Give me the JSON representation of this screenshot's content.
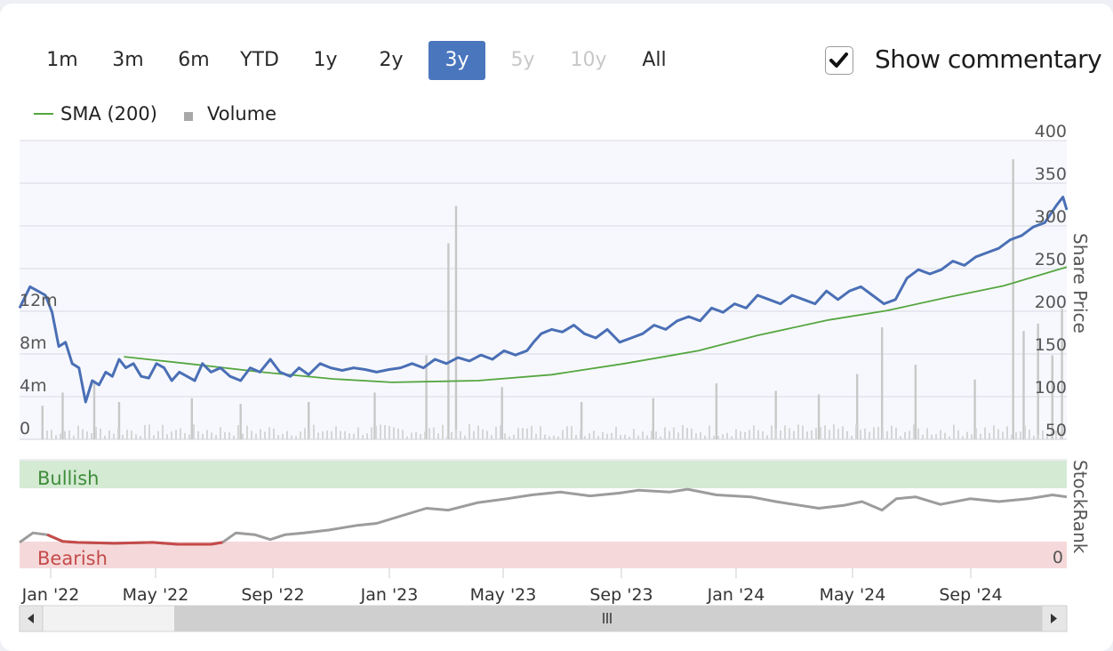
{
  "range_buttons": [
    {
      "label": "1m",
      "state": "normal"
    },
    {
      "label": "3m",
      "state": "normal"
    },
    {
      "label": "6m",
      "state": "normal"
    },
    {
      "label": "YTD",
      "state": "normal"
    },
    {
      "label": "1y",
      "state": "normal"
    },
    {
      "label": "2y",
      "state": "normal"
    },
    {
      "label": "3y",
      "state": "active"
    },
    {
      "label": "5y",
      "state": "disabled"
    },
    {
      "label": "10y",
      "state": "disabled"
    },
    {
      "label": "All",
      "state": "normal"
    }
  ],
  "commentary": {
    "label": "Show commentary",
    "checked": true
  },
  "colors": {
    "accent": "#4a76be",
    "price_line": "#4a6fb5",
    "sma_line": "#55a640",
    "volume_bar": "#c8c8c8",
    "bullish_band": "#d4ead3",
    "bearish_band": "#f5d9da",
    "bullish_text": "#3f8c3a",
    "bearish_text": "#c54a4a",
    "rank_line": "#9c9c9c",
    "rank_bearish_line": "#c54a4a"
  },
  "chart_data": {
    "type": "line",
    "legend": [
      {
        "name": "SMA (200)",
        "marker": "line"
      },
      {
        "name": "Volume",
        "marker": "square"
      }
    ],
    "x_ticks": [
      "Jan '22",
      "May '22",
      "Sep '22",
      "Jan '23",
      "May '23",
      "Sep '23",
      "Jan '24",
      "May '24",
      "Sep '24"
    ],
    "x_range": [
      "2021-12-22",
      "2024-12-20"
    ],
    "price_axis": {
      "title": "Share Price",
      "ticks": [
        50,
        100,
        150,
        200,
        250,
        300,
        350,
        400
      ],
      "range": [
        50,
        400
      ],
      "position": "right"
    },
    "volume_axis": {
      "ticks": [
        "0",
        "4m",
        "8m",
        "12m"
      ],
      "values": [
        0,
        4000000,
        8000000,
        12000000
      ],
      "range": [
        0,
        16000000
      ],
      "position": "left"
    },
    "price_series": {
      "name": "Share Price",
      "x": [
        "2021-12-22",
        "2022-01-02",
        "2022-01-10",
        "2022-01-18",
        "2022-01-25",
        "2022-02-01",
        "2022-02-08",
        "2022-02-15",
        "2022-02-22",
        "2022-03-01",
        "2022-03-08",
        "2022-03-15",
        "2022-03-22",
        "2022-03-29",
        "2022-04-05",
        "2022-04-12",
        "2022-04-20",
        "2022-04-28",
        "2022-05-06",
        "2022-05-14",
        "2022-05-22",
        "2022-05-30",
        "2022-06-07",
        "2022-06-15",
        "2022-06-23",
        "2022-07-01",
        "2022-07-10",
        "2022-07-20",
        "2022-07-30",
        "2022-08-10",
        "2022-08-20",
        "2022-08-30",
        "2022-09-10",
        "2022-09-20",
        "2022-10-01",
        "2022-10-10",
        "2022-10-20",
        "2022-11-01",
        "2022-11-12",
        "2022-11-24",
        "2022-12-06",
        "2022-12-18",
        "2022-12-30",
        "2023-01-12",
        "2023-01-24",
        "2023-02-05",
        "2023-02-17",
        "2023-03-01",
        "2023-03-13",
        "2023-03-25",
        "2023-04-06",
        "2023-04-18",
        "2023-04-30",
        "2023-05-12",
        "2023-05-24",
        "2023-06-05",
        "2023-06-12",
        "2023-06-20",
        "2023-07-01",
        "2023-07-12",
        "2023-07-24",
        "2023-08-04",
        "2023-08-16",
        "2023-08-28",
        "2023-09-10",
        "2023-09-22",
        "2023-10-04",
        "2023-10-16",
        "2023-10-28",
        "2023-11-09",
        "2023-11-21",
        "2023-12-03",
        "2023-12-15",
        "2023-12-27",
        "2024-01-08",
        "2024-01-20",
        "2024-02-01",
        "2024-02-13",
        "2024-02-25",
        "2024-03-08",
        "2024-03-20",
        "2024-04-01",
        "2024-04-13",
        "2024-04-25",
        "2024-05-07",
        "2024-05-19",
        "2024-05-31",
        "2024-06-12",
        "2024-06-24",
        "2024-07-06",
        "2024-07-18",
        "2024-07-30",
        "2024-08-11",
        "2024-08-23",
        "2024-09-04",
        "2024-09-16",
        "2024-09-28",
        "2024-10-10",
        "2024-10-22",
        "2024-11-03",
        "2024-11-15",
        "2024-11-27",
        "2024-12-09",
        "2024-12-16",
        "2024-12-20"
      ],
      "y": [
        210,
        235,
        230,
        225,
        205,
        165,
        170,
        145,
        140,
        100,
        125,
        120,
        135,
        130,
        150,
        140,
        145,
        130,
        128,
        145,
        140,
        125,
        135,
        130,
        125,
        145,
        135,
        140,
        130,
        125,
        140,
        135,
        150,
        135,
        130,
        140,
        132,
        145,
        140,
        137,
        140,
        138,
        135,
        138,
        140,
        145,
        140,
        150,
        145,
        152,
        148,
        155,
        150,
        160,
        155,
        160,
        170,
        180,
        185,
        182,
        190,
        180,
        175,
        185,
        170,
        175,
        180,
        190,
        185,
        195,
        200,
        195,
        210,
        205,
        215,
        210,
        225,
        220,
        215,
        225,
        220,
        215,
        230,
        220,
        230,
        235,
        225,
        215,
        220,
        245,
        255,
        250,
        255,
        265,
        260,
        270,
        275,
        280,
        290,
        295,
        305,
        310,
        330,
        340,
        325
      ]
    },
    "sma_series": {
      "name": "SMA (200)",
      "x": [
        "2022-04-10",
        "2022-06-15",
        "2022-09-01",
        "2022-11-15",
        "2023-01-15",
        "2023-04-15",
        "2023-07-01",
        "2023-09-15",
        "2023-12-01",
        "2024-02-01",
        "2024-04-15",
        "2024-06-15",
        "2024-08-15",
        "2024-10-15",
        "2024-12-20"
      ],
      "y": [
        153,
        145,
        135,
        127,
        123,
        125,
        132,
        145,
        160,
        178,
        196,
        207,
        222,
        236,
        258
      ]
    },
    "volume_series": {
      "name": "Volume",
      "x": [
        "2022-01-15",
        "2022-02-05",
        "2022-03-10",
        "2022-04-05",
        "2022-06-20",
        "2022-08-10",
        "2022-10-20",
        "2022-12-28",
        "2023-02-20",
        "2023-03-15",
        "2023-03-23",
        "2023-05-10",
        "2023-08-01",
        "2023-10-15",
        "2023-12-20",
        "2024-02-20",
        "2024-04-05",
        "2024-05-15",
        "2024-06-10",
        "2024-07-15",
        "2024-09-15",
        "2024-10-25",
        "2024-11-05",
        "2024-11-20",
        "2024-12-05",
        "2024-12-15"
      ],
      "y": [
        1800000,
        2500000,
        3000000,
        2000000,
        2200000,
        1900000,
        2000000,
        2500000,
        4500000,
        10500000,
        12500000,
        2800000,
        2000000,
        2200000,
        3000000,
        2600000,
        2400000,
        3500000,
        6000000,
        4000000,
        3200000,
        15000000,
        5800000,
        6200000,
        4500000,
        7000000
      ]
    },
    "stockrank": {
      "title": "StockRank",
      "tick": 0,
      "bands": [
        "Bullish",
        "Bearish"
      ],
      "x": [
        "2021-12-22",
        "2022-01-05",
        "2022-01-20",
        "2022-02-05",
        "2022-02-20",
        "2022-04-01",
        "2022-05-10",
        "2022-06-05",
        "2022-07-10",
        "2022-07-22",
        "2022-08-05",
        "2022-08-25",
        "2022-09-10",
        "2022-09-25",
        "2022-10-15",
        "2022-11-10",
        "2022-12-10",
        "2022-12-30",
        "2023-01-25",
        "2023-02-20",
        "2023-03-15",
        "2023-04-15",
        "2023-05-15",
        "2023-06-10",
        "2023-07-10",
        "2023-08-10",
        "2023-09-10",
        "2023-09-30",
        "2023-11-01",
        "2023-11-20",
        "2023-12-20",
        "2024-01-25",
        "2024-02-20",
        "2024-03-10",
        "2024-04-05",
        "2024-05-01",
        "2024-05-20",
        "2024-06-10",
        "2024-06-25",
        "2024-07-15",
        "2024-08-10",
        "2024-09-10",
        "2024-10-10",
        "2024-11-10",
        "2024-12-05",
        "2024-12-20"
      ],
      "y": [
        2,
        12,
        10,
        3,
        2,
        1,
        2,
        0,
        0,
        2,
        12,
        10,
        5,
        10,
        12,
        15,
        20,
        22,
        30,
        38,
        36,
        44,
        48,
        52,
        55,
        51,
        54,
        57,
        55,
        58,
        52,
        50,
        45,
        42,
        38,
        41,
        45,
        36,
        48,
        50,
        42,
        48,
        45,
        48,
        52,
        50
      ]
    }
  }
}
